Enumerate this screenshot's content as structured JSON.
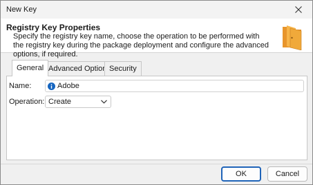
{
  "window": {
    "title": "New Key"
  },
  "header": {
    "title": "Registry Key Properties",
    "description": "Specify the registry key name, choose the operation to be performed with the registry key during the package deployment and configure the advanced options, if required.",
    "icon": "folder-icon"
  },
  "tabs": [
    {
      "label": "General",
      "active": true
    },
    {
      "label": "Advanced Options",
      "active": false
    },
    {
      "label": "Security",
      "active": false
    }
  ],
  "form": {
    "name_label": "Name:",
    "name_value": "Adobe",
    "operation_label": "Operation:",
    "operation_value": "Create"
  },
  "buttons": {
    "ok": "OK",
    "cancel": "Cancel"
  },
  "colors": {
    "accent": "#1e63b8",
    "folder": "#f0a93a",
    "info": "#1565c0"
  }
}
